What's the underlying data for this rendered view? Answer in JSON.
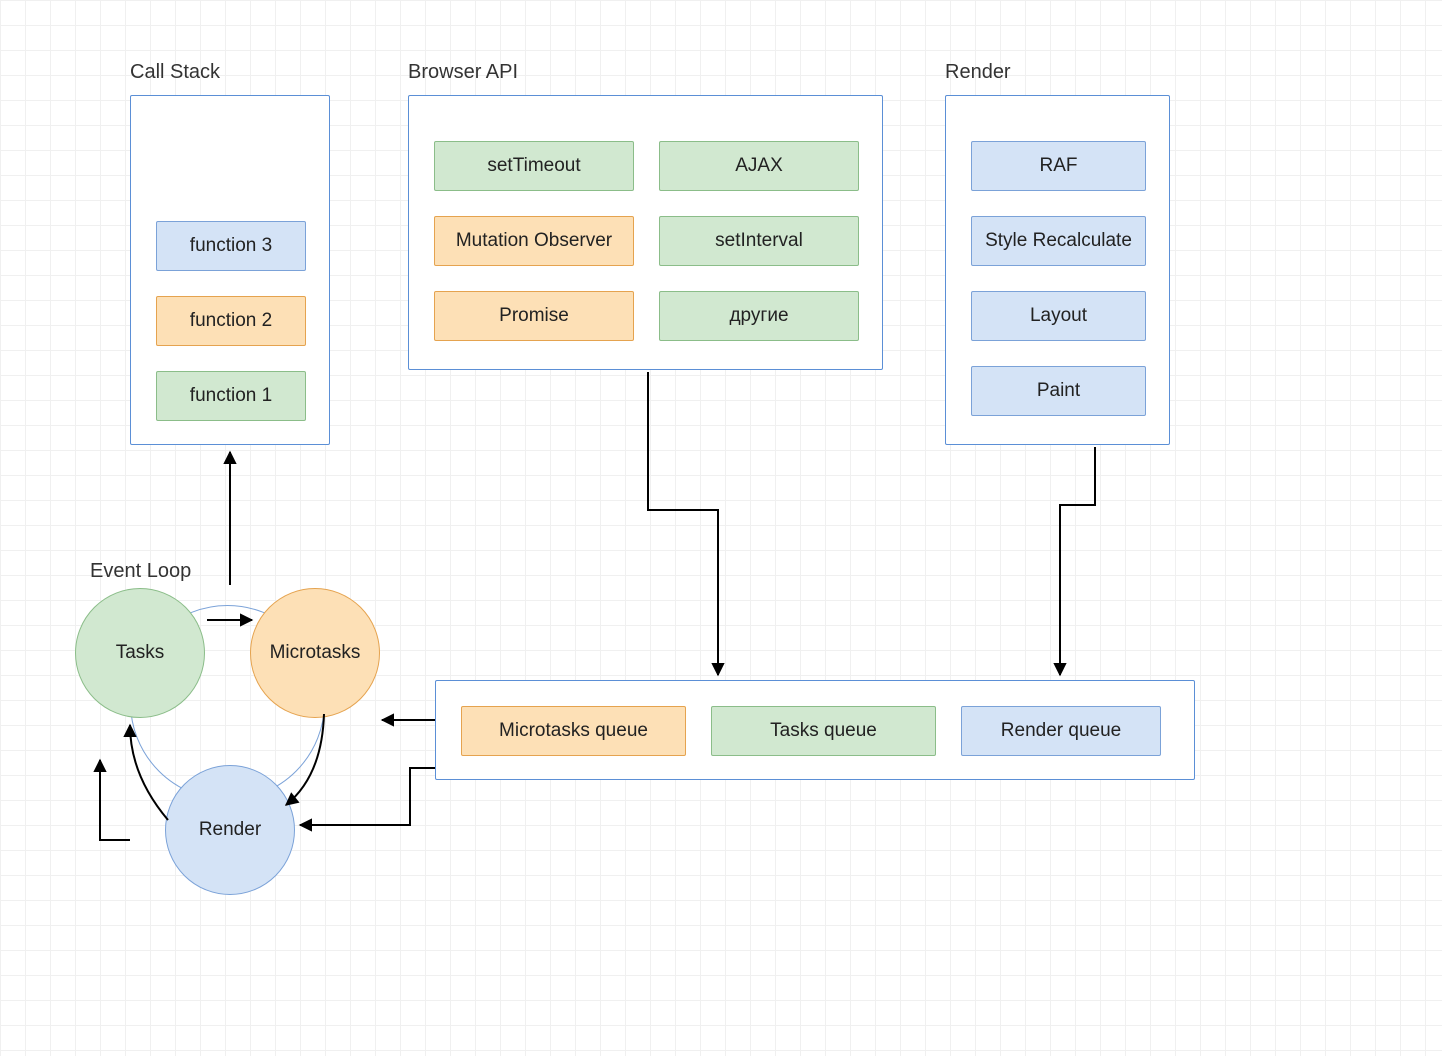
{
  "labels": {
    "call_stack": "Call Stack",
    "browser_api": "Browser API",
    "render": "Render",
    "event_loop": "Event Loop"
  },
  "call_stack": {
    "items": [
      "function 3",
      "function 2",
      "function 1"
    ]
  },
  "browser_api": {
    "row1": {
      "left": "setTimeout",
      "right": "AJAX"
    },
    "row2": {
      "left": "Mutation Observer",
      "right": "setInterval"
    },
    "row3": {
      "left": "Promise",
      "right": "другие"
    }
  },
  "render_pipeline": {
    "items": [
      "RAF",
      "Style Recalculate",
      "Layout",
      "Paint"
    ]
  },
  "event_loop": {
    "tasks": "Tasks",
    "microtasks": "Microtasks",
    "render": "Render"
  },
  "queues": {
    "microtasks": "Microtasks queue",
    "tasks": "Tasks queue",
    "render": "Render queue"
  }
}
